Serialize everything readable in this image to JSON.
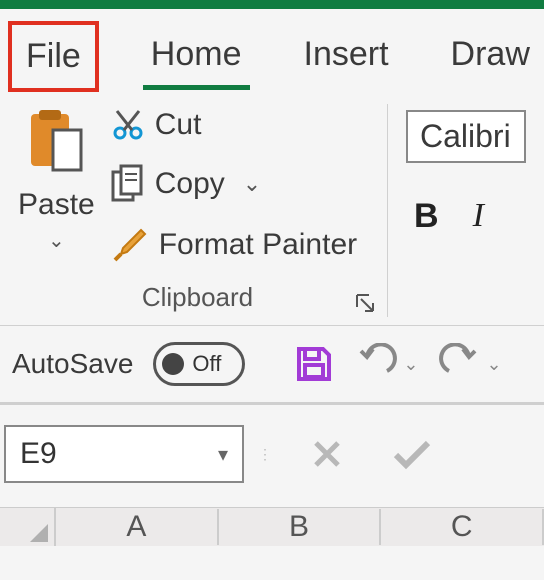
{
  "tabs": {
    "file": "File",
    "home": "Home",
    "insert": "Insert",
    "draw": "Draw"
  },
  "clipboard": {
    "paste": "Paste",
    "cut": "Cut",
    "copy": "Copy",
    "format_painter": "Format Painter",
    "group_label": "Clipboard"
  },
  "font": {
    "name": "Calibri",
    "bold": "B",
    "italic": "I"
  },
  "qat": {
    "autosave_label": "AutoSave",
    "toggle_state": "Off"
  },
  "formula_bar": {
    "cell_ref": "E9"
  },
  "columns": [
    "A",
    "B",
    "C"
  ]
}
